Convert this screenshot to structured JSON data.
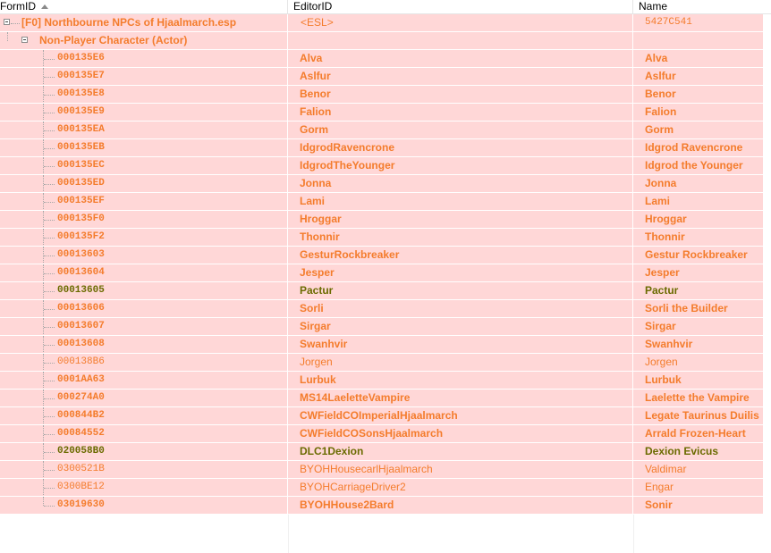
{
  "columns": {
    "formid": "FormID",
    "editorid": "EditorID",
    "name": "Name"
  },
  "file": {
    "label": "[F0] Northbourne NPCs of Hjaalmarch.esp",
    "editorid": "<ESL>",
    "name": "5427C541"
  },
  "group": {
    "label": "Non-Player Character (Actor)"
  },
  "records": [
    {
      "formid": "000135E6",
      "editorid": "Alva",
      "name": "Alva",
      "style": "b"
    },
    {
      "formid": "000135E7",
      "editorid": "Aslfur",
      "name": "Aslfur",
      "style": "b"
    },
    {
      "formid": "000135E8",
      "editorid": "Benor",
      "name": "Benor",
      "style": "b"
    },
    {
      "formid": "000135E9",
      "editorid": "Falion",
      "name": "Falion",
      "style": "b"
    },
    {
      "formid": "000135EA",
      "editorid": "Gorm",
      "name": "Gorm",
      "style": "b"
    },
    {
      "formid": "000135EB",
      "editorid": "IdgrodRavencrone",
      "name": "Idgrod Ravencrone",
      "style": "b"
    },
    {
      "formid": "000135EC",
      "editorid": "IdgrodTheYounger",
      "name": "Idgrod the Younger",
      "style": "b"
    },
    {
      "formid": "000135ED",
      "editorid": "Jonna",
      "name": "Jonna",
      "style": "b"
    },
    {
      "formid": "000135EF",
      "editorid": "Lami",
      "name": "Lami",
      "style": "b"
    },
    {
      "formid": "000135F0",
      "editorid": "Hroggar",
      "name": "Hroggar",
      "style": "b"
    },
    {
      "formid": "000135F2",
      "editorid": "Thonnir",
      "name": "Thonnir",
      "style": "b"
    },
    {
      "formid": "00013603",
      "editorid": "GesturRockbreaker",
      "name": "Gestur Rockbreaker",
      "style": "b"
    },
    {
      "formid": "00013604",
      "editorid": "Jesper",
      "name": "Jesper",
      "style": "b"
    },
    {
      "formid": "00013605",
      "editorid": "Pactur",
      "name": "Pactur",
      "style": "g"
    },
    {
      "formid": "00013606",
      "editorid": "Sorli",
      "name": "Sorli the Builder",
      "style": "b"
    },
    {
      "formid": "00013607",
      "editorid": "Sirgar",
      "name": "Sirgar",
      "style": "b"
    },
    {
      "formid": "00013608",
      "editorid": "Swanhvir",
      "name": "Swanhvir",
      "style": "b"
    },
    {
      "formid": "000138B6",
      "editorid": "Jorgen",
      "name": "Jorgen",
      "style": "n"
    },
    {
      "formid": "0001AA63",
      "editorid": "Lurbuk",
      "name": "Lurbuk",
      "style": "b"
    },
    {
      "formid": "000274A0",
      "editorid": "MS14LaeletteVampire",
      "name": "Laelette the Vampire",
      "style": "b"
    },
    {
      "formid": "000844B2",
      "editorid": "CWFieldCOImperialHjaalmarch",
      "name": "Legate Taurinus Duilis",
      "style": "b"
    },
    {
      "formid": "00084552",
      "editorid": "CWFieldCOSonsHjaalmarch",
      "name": "Arrald Frozen-Heart",
      "style": "b"
    },
    {
      "formid": "020058B0",
      "editorid": "DLC1Dexion",
      "name": "Dexion Evicus",
      "style": "g"
    },
    {
      "formid": "0300521B",
      "editorid": "BYOHHousecarlHjaalmarch",
      "name": "Valdimar",
      "style": "n"
    },
    {
      "formid": "0300BE12",
      "editorid": "BYOHCarriageDriver2",
      "name": "Engar",
      "style": "n"
    },
    {
      "formid": "03019630",
      "editorid": "BYOHHouse2Bard",
      "name": "Sonir",
      "style": "b"
    }
  ],
  "colors": {
    "row_bg": "#ffd7d7",
    "text_orange": "#f47c2c",
    "text_olive": "#6b6b00"
  },
  "icons": {
    "sort": "sort-ascending-icon",
    "expand": "collapse-minus-icon"
  }
}
